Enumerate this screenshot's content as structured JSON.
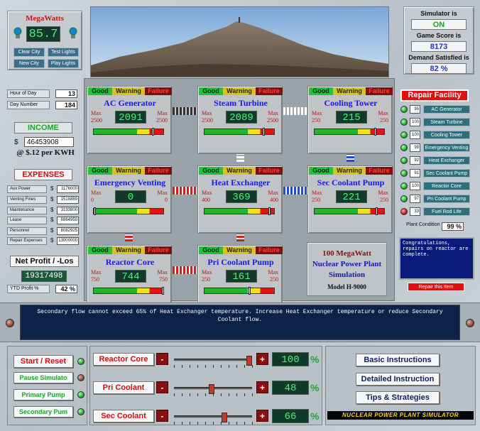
{
  "megawatts": {
    "title": "MegaWatts",
    "value": "85.7",
    "buttons": [
      "Clear City",
      "Test Lights",
      "New City",
      "Play Lights"
    ]
  },
  "simulator": {
    "status_label": "Simulator is",
    "status": "ON",
    "score_label": "Game Score is",
    "score": "8173",
    "demand_label": "Demand Satisfied is",
    "demand": "82 %"
  },
  "time": {
    "hour_label": "Hour of Day",
    "hour": "13",
    "day_label": "Day Number",
    "day": "184"
  },
  "income": {
    "label": "INCOME",
    "currency": "$",
    "value": "46453908",
    "rate": "@ $.12 per KWH"
  },
  "expenses": {
    "label": "EXPENSES",
    "rows": [
      {
        "label": "Aux Power",
        "value": "1176000"
      },
      {
        "label": "Venting Fines",
        "value": "1518889"
      },
      {
        "label": "Maintenance",
        "value": "3193800"
      },
      {
        "label": "Lease",
        "value": "6864950"
      },
      {
        "label": "Personnel",
        "value": "8082925"
      },
      {
        "label": "Repair Expenses",
        "value": "13000000"
      }
    ]
  },
  "profit": {
    "label": "Net Profit / -Los",
    "value": "19317498",
    "ytd_label": "YTD Profit %",
    "ytd": "42 %"
  },
  "status_labels": {
    "good": "Good",
    "warning": "Warning",
    "failure": "Failure"
  },
  "components": {
    "ac_generator": {
      "name": "AC Generator",
      "max_label": "Max",
      "max_left": "2500",
      "max_right": "2500",
      "value": "2091",
      "level": 0.84
    },
    "steam_turbine": {
      "name": "Steam Turbine",
      "max_label": "Max",
      "max_left": "2500",
      "max_right": "2500",
      "value": "2089",
      "level": 0.84
    },
    "cooling_tower": {
      "name": "Cooling Tower",
      "max_label": "Max",
      "max_left": "250",
      "max_right": "250",
      "value": "215",
      "level": 0.86
    },
    "emergency_venting": {
      "name": "Emergency Venting",
      "max_label": "Max",
      "max_left": "0",
      "max_right": "0",
      "value": "0",
      "level": 0.02
    },
    "heat_exchanger": {
      "name": "Heat Exchanger",
      "max_label": "Max",
      "max_left": "400",
      "max_right": "400",
      "value": "369",
      "level": 0.92
    },
    "sec_coolant_pump": {
      "name": "Sec Coolant Pump",
      "max_label": "Max",
      "max_left": "250",
      "max_right": "250",
      "value": "221",
      "level": 0.88
    },
    "reactor_core": {
      "name": "Reactor Core",
      "max_label": "Max",
      "max_left": "750",
      "max_right": "750",
      "value": "744",
      "level": 0.99
    },
    "pri_coolant_pump": {
      "name": "Pri Coolant Pump",
      "max_label": "Max",
      "max_left": "250",
      "max_right": "250",
      "value": "161",
      "level": 0.64
    }
  },
  "plant_info": {
    "line1": "100 MegaWatt",
    "line2": "Nuclear Power Plant",
    "line3": "Simulation",
    "model": "Model H-9000"
  },
  "repair": {
    "title": "Repair Facility",
    "items": [
      {
        "value": "95",
        "label": "AC Generator",
        "led": "green"
      },
      {
        "value": "100",
        "label": "Steam Turbine",
        "led": "green"
      },
      {
        "value": "100",
        "label": "Cooling Tower",
        "led": "green"
      },
      {
        "value": "99",
        "label": "Emergency Venting",
        "led": "green"
      },
      {
        "value": "92",
        "label": "Heat Exchanger",
        "led": "green"
      },
      {
        "value": "91",
        "label": "Sec Coolant Pump",
        "led": "green"
      },
      {
        "value": "100",
        "label": "Reactor Core",
        "led": "green"
      },
      {
        "value": "97",
        "label": "Pri Coolant Pump",
        "led": "green"
      },
      {
        "value": "33",
        "label": "Fuel Rod Life",
        "led": "red"
      }
    ],
    "plant_condition_label": "Plant Condition",
    "plant_condition": "99 %",
    "message": "Congratulations, repairs on reactor are complete.",
    "repair_button": "Repair this Item"
  },
  "message": "Secondary flow cannot exceed 65% of Heat Exchanger temperature. Increase Heat Exchanger temperature or reduce Secondary Coolant flow.",
  "controls": {
    "start_reset": "Start / Reset",
    "pause": "Pause Simulato",
    "primary_pump": "Primary Pump",
    "secondary_pump": "Secondary Pum"
  },
  "sliders": [
    {
      "label": "Reactor Core",
      "value": "100",
      "level": 1.0,
      "minus": "-",
      "plus": "+",
      "unit": "%"
    },
    {
      "label": "Pri Coolant",
      "value": "48",
      "level": 0.48,
      "minus": "-",
      "plus": "+",
      "unit": "%"
    },
    {
      "label": "Sec Coolant",
      "value": "66",
      "level": 0.66,
      "minus": "-",
      "plus": "+",
      "unit": "%"
    }
  ],
  "help": {
    "basic": "Basic Instructions",
    "detailed": "Detailed Instruction",
    "tips": "Tips & Strategies",
    "logo": "NUCLEAR POWER PLANT SIMULATOR"
  },
  "colors": {
    "lcd_bg": "#123a2a",
    "lcd_text": "#4cf07a",
    "component_title": "#1a1ae0",
    "max_text": "#c01010",
    "repair_title_bg": "#e01010"
  }
}
